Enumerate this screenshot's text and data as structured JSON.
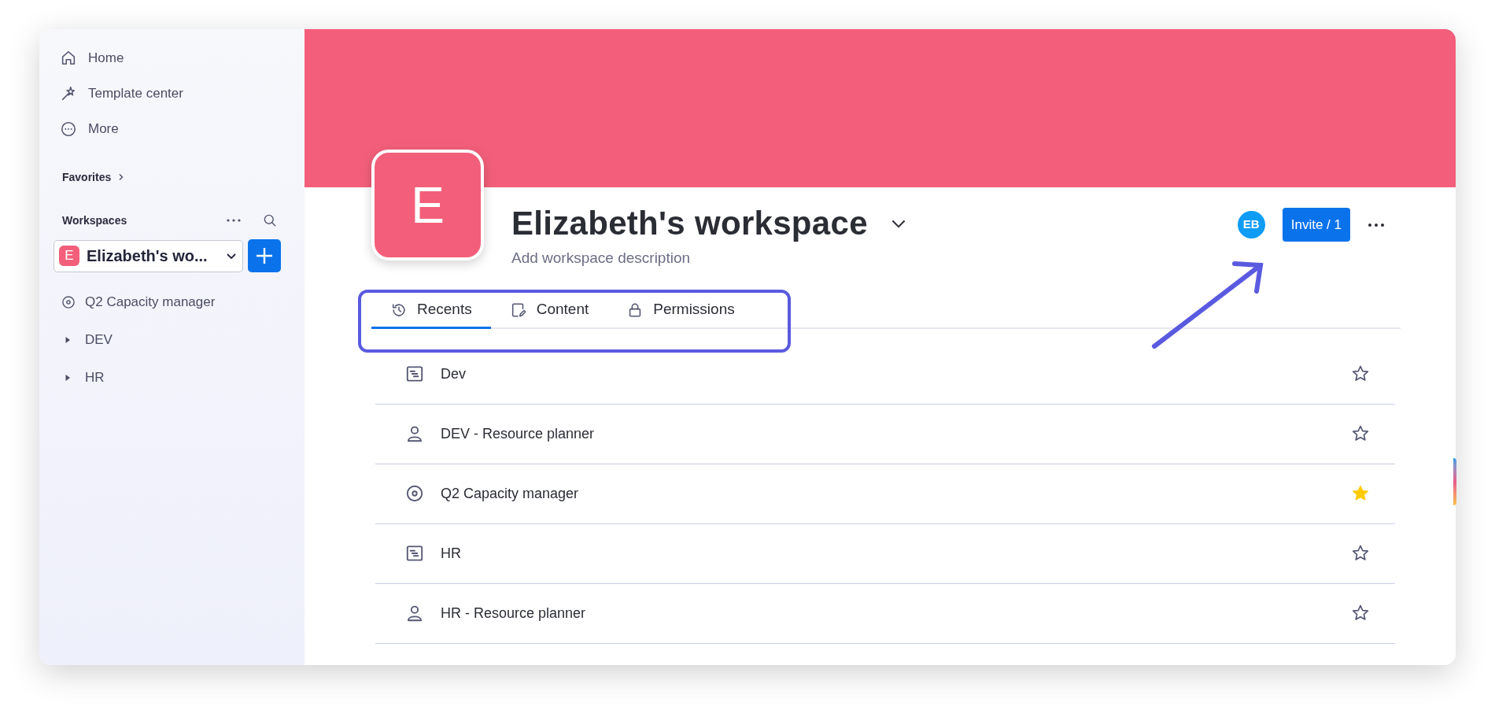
{
  "sidebar": {
    "nav": [
      {
        "kind": "home",
        "label": "Home"
      },
      {
        "kind": "template",
        "label": "Template center"
      },
      {
        "kind": "more",
        "label": "More"
      }
    ],
    "favorites": {
      "label": "Favorites"
    },
    "workspaces": {
      "label": "Workspaces",
      "selector": {
        "badge": "E",
        "name": "Elizabeth's wo..."
      }
    },
    "tree": [
      {
        "kind": "dashboard",
        "label": "Q2 Capacity manager"
      },
      {
        "kind": "folder",
        "label": "DEV",
        "expanded": false
      },
      {
        "kind": "folder",
        "label": "HR",
        "expanded": false
      }
    ]
  },
  "workspace": {
    "badge": "E",
    "title": "Elizabeth's workspace",
    "description": "Add workspace description",
    "member": "EB",
    "invite": "Invite / 1"
  },
  "tabs": [
    {
      "kind": "recents",
      "label": "Recents",
      "selected": true
    },
    {
      "kind": "content",
      "label": "Content",
      "selected": false
    },
    {
      "kind": "permissions",
      "label": "Permissions",
      "selected": false
    }
  ],
  "recents": [
    {
      "kind": "board",
      "label": "Dev",
      "favorite": false
    },
    {
      "kind": "person",
      "label": "DEV - Resource planner",
      "favorite": false
    },
    {
      "kind": "dashboard",
      "label": "Q2 Capacity manager",
      "favorite": true
    },
    {
      "kind": "board",
      "label": "HR",
      "favorite": false
    },
    {
      "kind": "person",
      "label": "HR - Resource planner",
      "favorite": false
    }
  ]
}
